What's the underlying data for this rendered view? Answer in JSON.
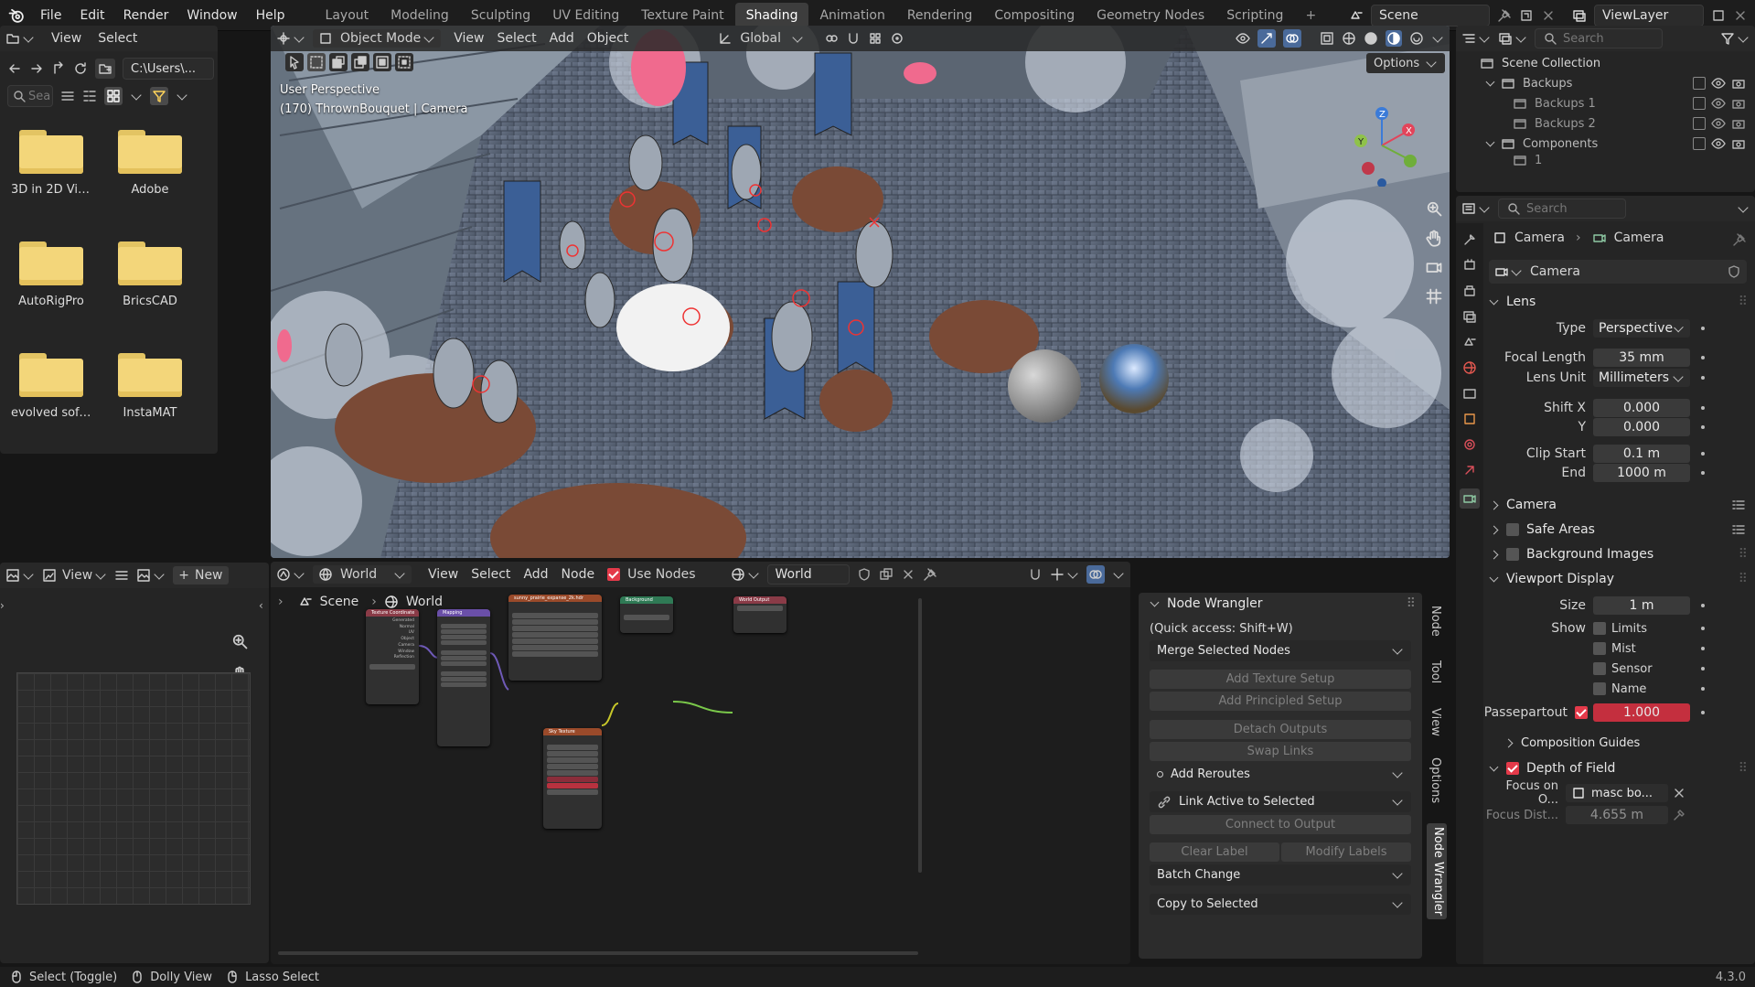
{
  "topbar": {
    "menus": [
      "File",
      "Edit",
      "Render",
      "Window",
      "Help"
    ],
    "workspaces": [
      "Layout",
      "Modeling",
      "Sculpting",
      "UV Editing",
      "Texture Paint",
      "Shading",
      "Animation",
      "Rendering",
      "Compositing",
      "Geometry Nodes",
      "Scripting"
    ],
    "active_workspace": "Shading",
    "scene": "Scene",
    "view_layer": "ViewLayer"
  },
  "file_browser": {
    "menu": [
      "View",
      "Select"
    ],
    "path": "C:\\Users\\...",
    "search_placeholder": "Sea",
    "folders": [
      "3D in 2D Vie...",
      "Adobe",
      "AutoRigPro",
      "BricsCAD",
      "evolved soft...",
      "InstaMAT",
      "",
      ""
    ]
  },
  "viewport": {
    "mode": "Object Mode",
    "menu": [
      "View",
      "Select",
      "Add",
      "Object"
    ],
    "transform": "Global",
    "options": "Options",
    "overlay_title": "User Perspective",
    "overlay_sub": "(170) ThrownBouquet | Camera"
  },
  "image_editor": {
    "view": "View",
    "new": "New"
  },
  "node_editor": {
    "world_type": "World",
    "menu": [
      "View",
      "Select",
      "Add",
      "Node"
    ],
    "use_nodes": "Use Nodes",
    "world_name": "World",
    "breadcrumb": [
      "Scene",
      "World"
    ],
    "tabs": [
      "Node",
      "Tool",
      "View",
      "Options",
      "Node Wrangler"
    ],
    "nodes": [
      "Texture Coordinate",
      "Mapping",
      "sunny_prairie_expanse_2k.hdr",
      "Background",
      "World Output",
      "Sky Texture"
    ]
  },
  "node_wrangler": {
    "title": "Node Wrangler",
    "hint": "(Quick access: Shift+W)",
    "merge": "Merge Selected Nodes",
    "add_texture_setup": "Add Texture Setup",
    "add_principled_setup": "Add Principled Setup",
    "detach_outputs": "Detach Outputs",
    "swap_links": "Swap Links",
    "add_reroutes": "Add Reroutes",
    "link_active": "Link Active to Selected",
    "connect_output": "Connect to Output",
    "clear_label": "Clear Label",
    "modify_labels": "Modify Labels",
    "batch_change": "Batch Change",
    "copy_to_selected": "Copy to Selected"
  },
  "outliner": {
    "search_placeholder": "Search",
    "items": [
      {
        "label": "Scene Collection",
        "indent": 0
      },
      {
        "label": "Backups",
        "indent": 1
      },
      {
        "label": "Backups 1",
        "indent": 2
      },
      {
        "label": "Backups 2",
        "indent": 2
      },
      {
        "label": "Components",
        "indent": 1
      },
      {
        "label": "1",
        "indent": 2
      }
    ]
  },
  "properties": {
    "search_placeholder": "Search",
    "breadcrumb": [
      "Camera",
      "Camera"
    ],
    "datablock": "Camera",
    "lens_title": "Lens",
    "type_label": "Type",
    "type_value": "Perspective",
    "focal_label": "Focal Length",
    "focal_value": "35 mm",
    "lens_unit_label": "Lens Unit",
    "lens_unit_value": "Millimeters",
    "shift_x_label": "Shift X",
    "shift_x_value": "0.000",
    "shift_y_label": "Y",
    "shift_y_value": "0.000",
    "clip_start_label": "Clip Start",
    "clip_start_value": "0.1 m",
    "clip_end_label": "End",
    "clip_end_value": "1000 m",
    "camera_section": "Camera",
    "safe_areas": "Safe Areas",
    "background_images": "Background Images",
    "viewport_display": "Viewport Display",
    "size_label": "Size",
    "size_value": "1 m",
    "show_label": "Show",
    "show_items": [
      "Limits",
      "Mist",
      "Sensor",
      "Name"
    ],
    "passepartout_label": "Passepartout",
    "passepartout_value": "1.000",
    "composition_guides": "Composition Guides",
    "dof": "Depth of Field",
    "focus_obj_label": "Focus on O...",
    "focus_obj_value": "masc bo...",
    "focus_dist_label": "Focus Dist...",
    "focus_dist_value": "4.655 m"
  },
  "status": {
    "select": "Select (Toggle)",
    "dolly": "Dolly View",
    "lasso": "Lasso Select",
    "version": "4.3.0"
  },
  "colors": {
    "accent": "#e43a4a",
    "active_tab": "#3d3d3d",
    "folder": "#f3d67a"
  }
}
